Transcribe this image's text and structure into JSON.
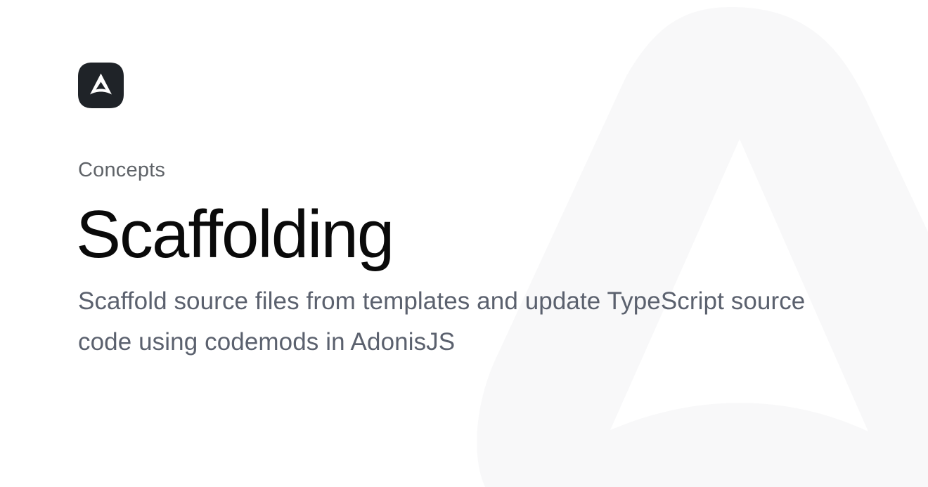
{
  "header": {
    "logo_icon": "adonisjs-logo-icon"
  },
  "page": {
    "eyebrow": "Concepts",
    "title": "Scaffolding",
    "description": "Scaffold source files from templates and update TypeScript source code using codemods in AdonisJS"
  },
  "colors": {
    "title": "#0a0a0a",
    "eyebrow": "#5f6368",
    "description": "#5b616e",
    "logo": "#1f2328",
    "background_mark": "#f7f7f8"
  }
}
